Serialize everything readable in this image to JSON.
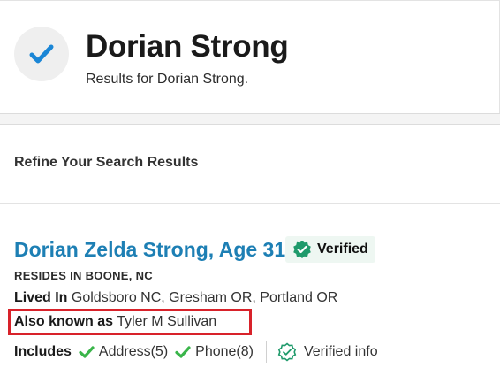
{
  "header": {
    "title": "Dorian Strong",
    "subtitle": "Results for Dorian Strong."
  },
  "refine": {
    "title": "Refine Your Search Results"
  },
  "result": {
    "name": "Dorian Zelda Strong, Age 31",
    "verified_label": "Verified",
    "resides": "RESIDES IN BOONE, NC",
    "lived_in_label": "Lived In",
    "lived_in_value": "Goldsboro NC, Gresham OR, Portland OR",
    "aka_label": "Also known as",
    "aka_value": "Tyler M Sullivan",
    "includes_label": "Includes",
    "includes": [
      {
        "label": "Address(5)"
      },
      {
        "label": "Phone(8)"
      }
    ],
    "verified_info_label": "Verified info"
  },
  "colors": {
    "accent_blue": "#1d7fb4",
    "check_blue": "#1b86d6",
    "verified_green": "#1f9a6b",
    "include_green": "#3ab54a",
    "highlight_red": "#d8222a"
  }
}
